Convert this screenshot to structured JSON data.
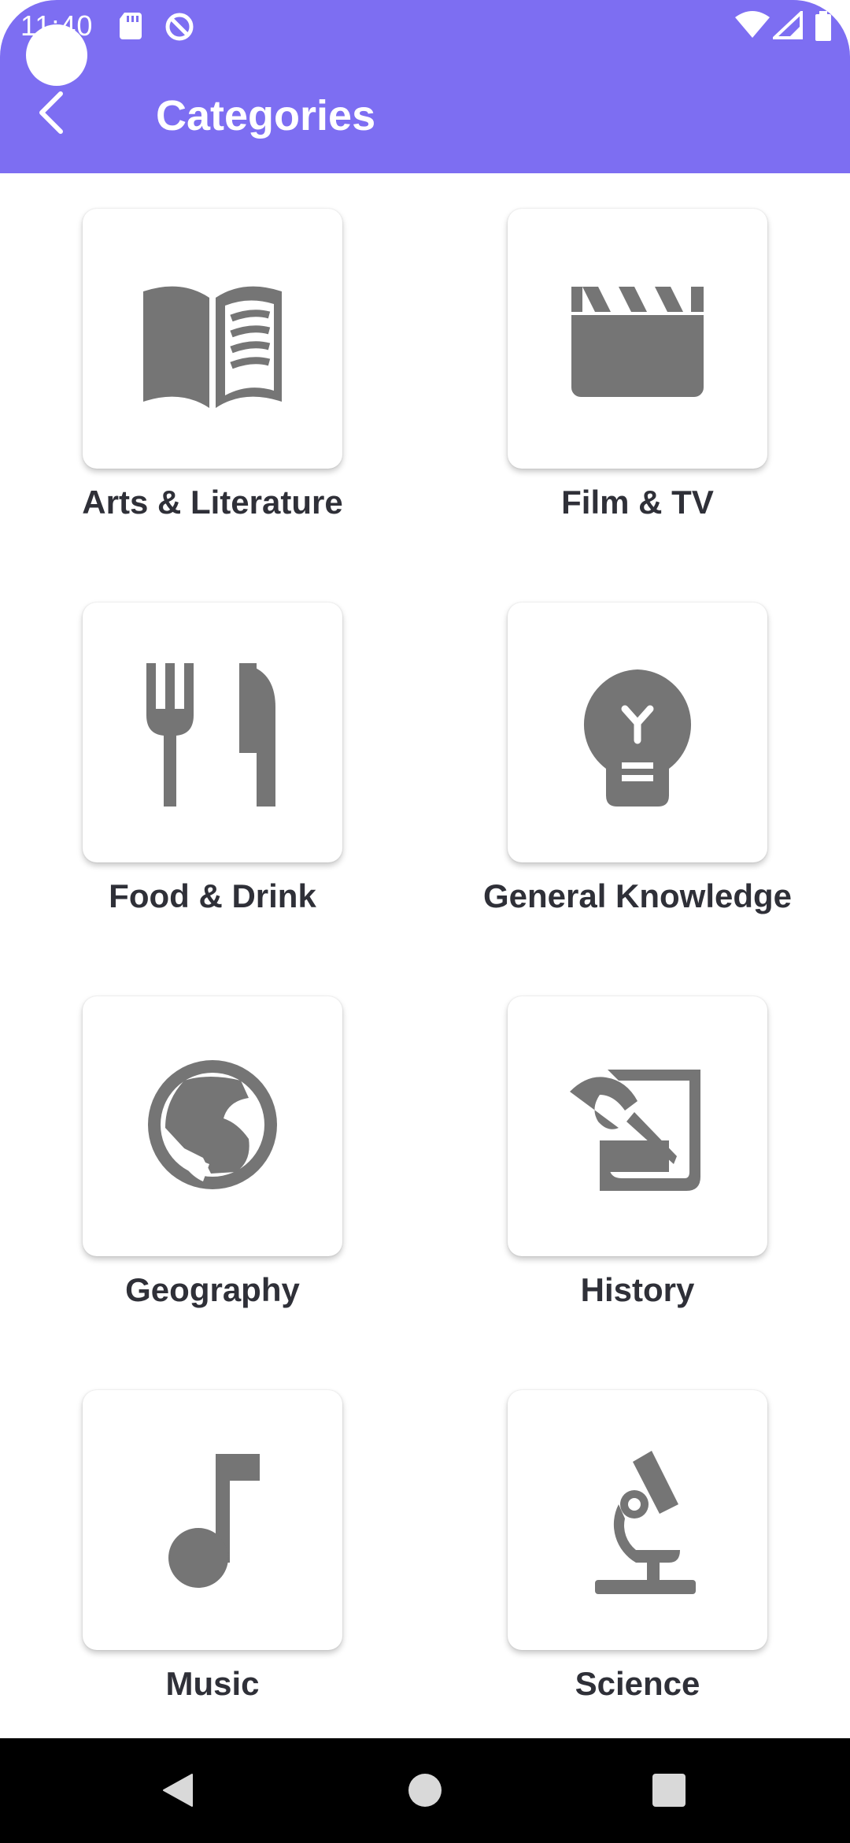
{
  "status_bar": {
    "time": "11:40",
    "icons": [
      "sd-card-icon",
      "do-not-disturb-icon",
      "wifi-icon",
      "cellular-signal-icon",
      "battery-icon"
    ]
  },
  "app_bar": {
    "title": "Categories",
    "back_icon": "chevron-left-icon",
    "background_color": "#7d6ef2"
  },
  "categories": [
    {
      "label": "Arts & Literature",
      "icon": "open-book-icon"
    },
    {
      "label": "Film & TV",
      "icon": "clapperboard-icon"
    },
    {
      "label": "Food & Drink",
      "icon": "fork-knife-icon"
    },
    {
      "label": "General Knowledge",
      "icon": "lightbulb-icon"
    },
    {
      "label": "Geography",
      "icon": "globe-icon"
    },
    {
      "label": "History",
      "icon": "history-scroll-icon"
    },
    {
      "label": "Music",
      "icon": "music-note-icon"
    },
    {
      "label": "Science",
      "icon": "microscope-icon"
    }
  ],
  "colors": {
    "icon": "#757575",
    "label": "#2f3038",
    "nav_bar": "#000000"
  },
  "nav_bar": {
    "icons": [
      "back-triangle-icon",
      "home-circle-icon",
      "recents-square-icon"
    ]
  }
}
